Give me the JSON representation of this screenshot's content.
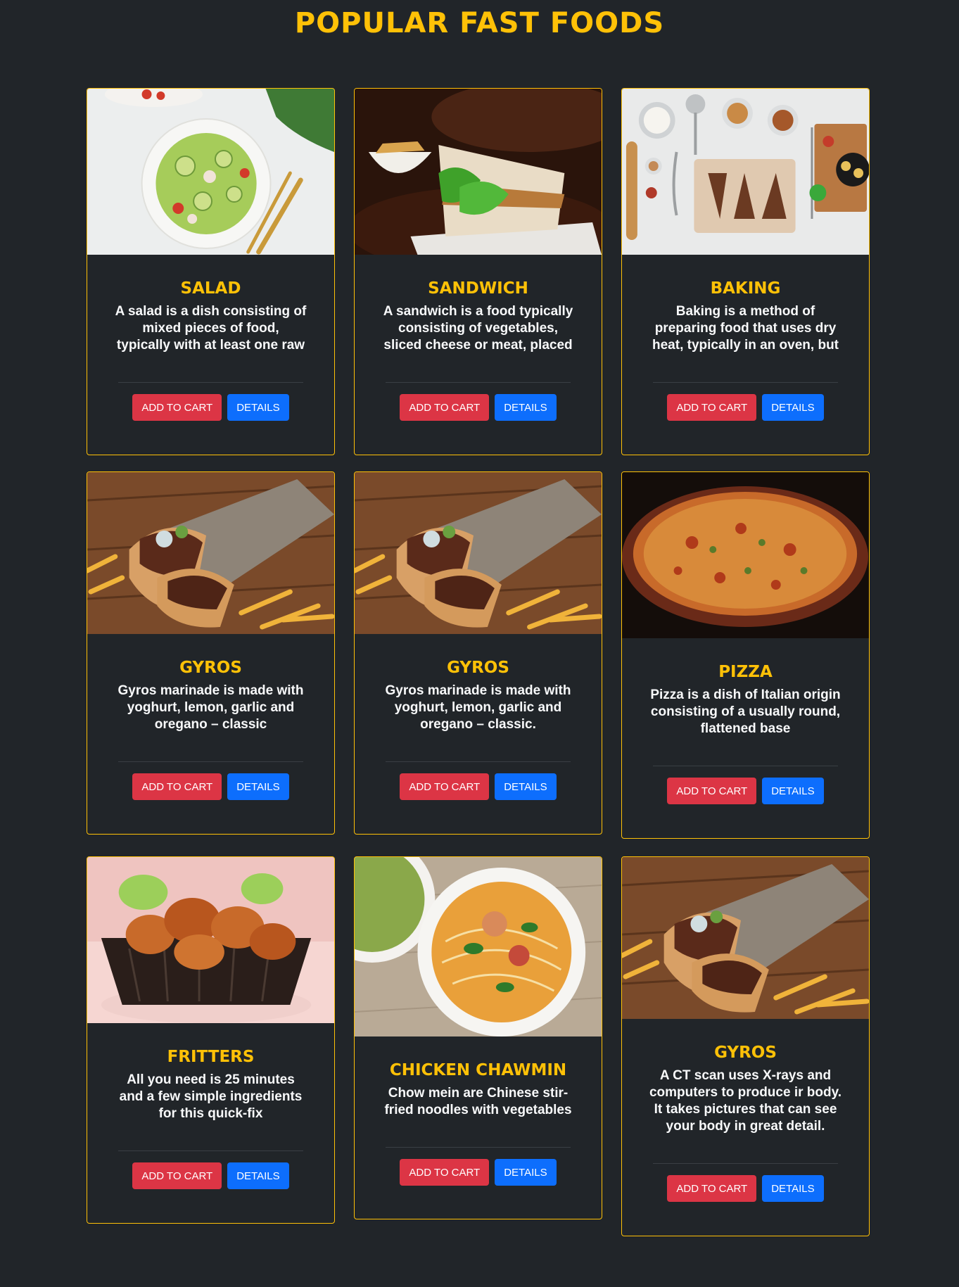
{
  "page": {
    "title": "POPULAR FAST FOODS"
  },
  "buttons": {
    "add_to_cart": "ADD TO CART",
    "details": "DETAILS"
  },
  "colors": {
    "accent": "#ffc107",
    "background": "#212529",
    "cart": "#dc3545",
    "details": "#0d6efd"
  },
  "cards": [
    {
      "title": "SALAD",
      "text": "A salad is a dish consisting of mixed pieces of food, typically with at least one raw ingredient.",
      "image": "salad-photo"
    },
    {
      "title": "SANDWICH",
      "text": "A sandwich is a food typically consisting of vegetables, sliced cheese or meat, placed on or",
      "image": "sandwich-photo"
    },
    {
      "title": "BAKING",
      "text": "Baking is a method of preparing food that uses dry heat, typically in an oven, but can also be done",
      "image": "baking-photo"
    },
    {
      "title": "GYROS",
      "text": "Gyros marinade is made with yoghurt, lemon, garlic and oregano – classic",
      "image": "gyros-photo"
    },
    {
      "title": "GYROS",
      "text": "Gyros marinade is made with yoghurt, lemon, garlic and oregano – classic.",
      "image": "gyros-photo"
    },
    {
      "title": "PIZZA",
      "text": "Pizza is a dish of Italian origin consisting of a usually round, flattened base",
      "image": "pizza-photo"
    },
    {
      "title": "FRITTERS",
      "text": "All you need is 25 minutes and a few simple ingredients for this quick-fix",
      "image": "fritters-photo"
    },
    {
      "title": "CHICKEN CHAWMIN",
      "text": "Chow mein are Chinese stir-fried noodles with vegetables",
      "image": "chawmin-photo"
    },
    {
      "title": "GYROS",
      "text": "A CT scan uses X-rays and computers to produce ir body. It takes pictures that can see your body in great detail.",
      "image": "gyros-photo"
    }
  ]
}
